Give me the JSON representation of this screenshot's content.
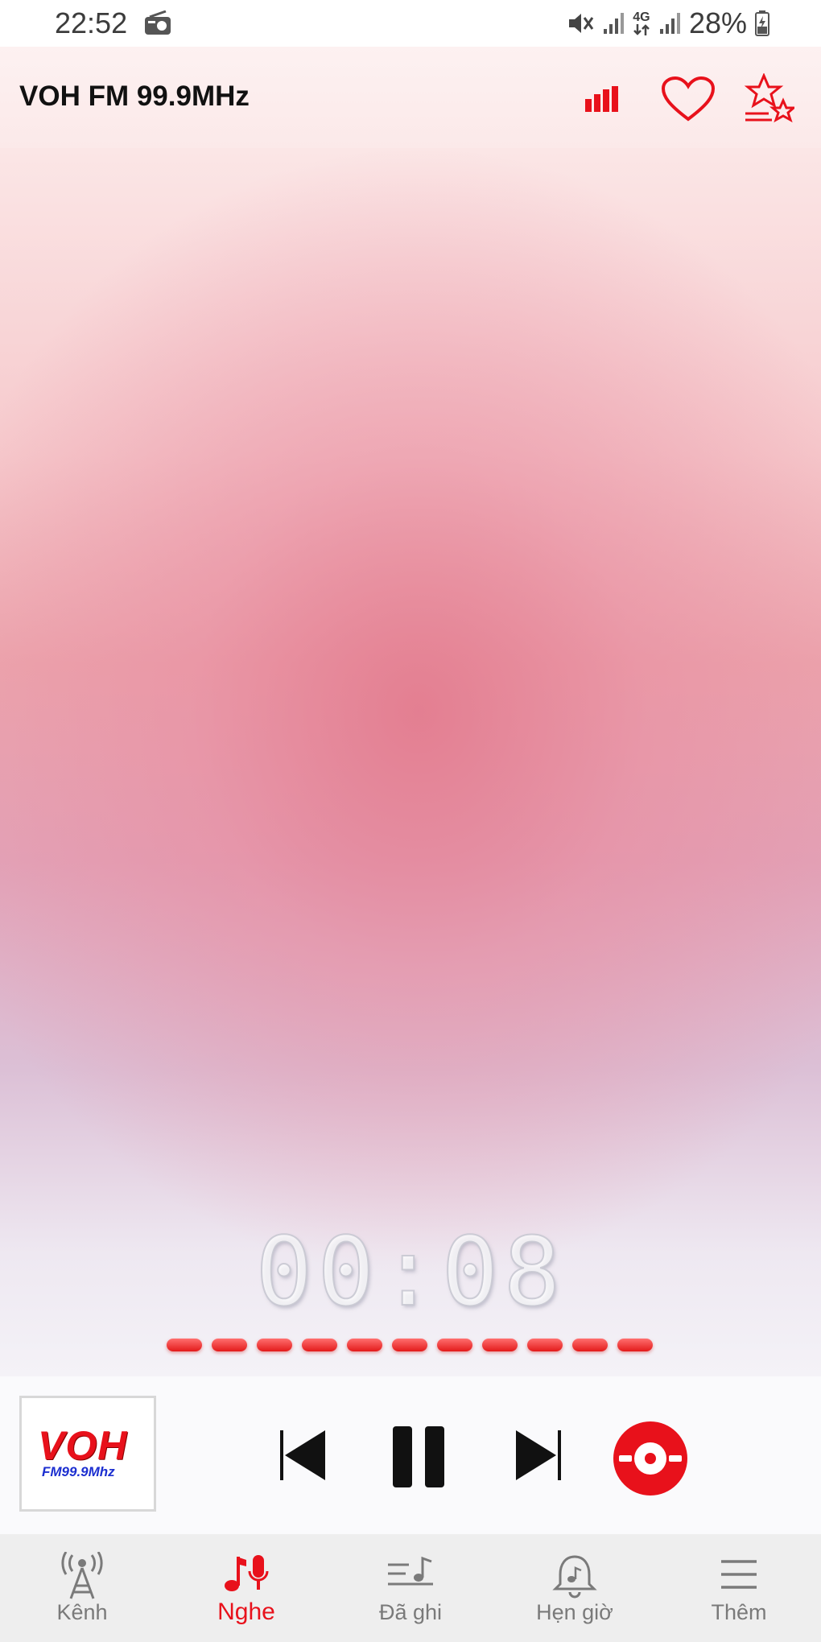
{
  "status_bar": {
    "time": "22:52",
    "network": "4G",
    "battery": "28%"
  },
  "header": {
    "title": "VOH FM 99.9MHz",
    "icons": [
      "equalizer-icon",
      "heart-icon",
      "favorites-list-icon"
    ]
  },
  "player": {
    "timer": "00:08",
    "level_segments": 11,
    "logo": {
      "main": "VOH",
      "sub": "FM99.9Mhz"
    },
    "controls": [
      "previous-icon",
      "pause-icon",
      "next-icon",
      "record-icon"
    ]
  },
  "nav": {
    "items": [
      {
        "label": "Kênh",
        "icon": "radio-tower-icon",
        "active": false
      },
      {
        "label": "Nghe",
        "icon": "listen-icon",
        "active": true
      },
      {
        "label": "Đã ghi",
        "icon": "recorded-icon",
        "active": false
      },
      {
        "label": "Hẹn giờ",
        "icon": "alarm-icon",
        "active": false
      },
      {
        "label": "Thêm",
        "icon": "menu-icon",
        "active": false
      }
    ]
  },
  "colors": {
    "accent": "#e8111b",
    "nav_inactive": "#7a7a7a",
    "nav_background": "#eeeeee"
  }
}
